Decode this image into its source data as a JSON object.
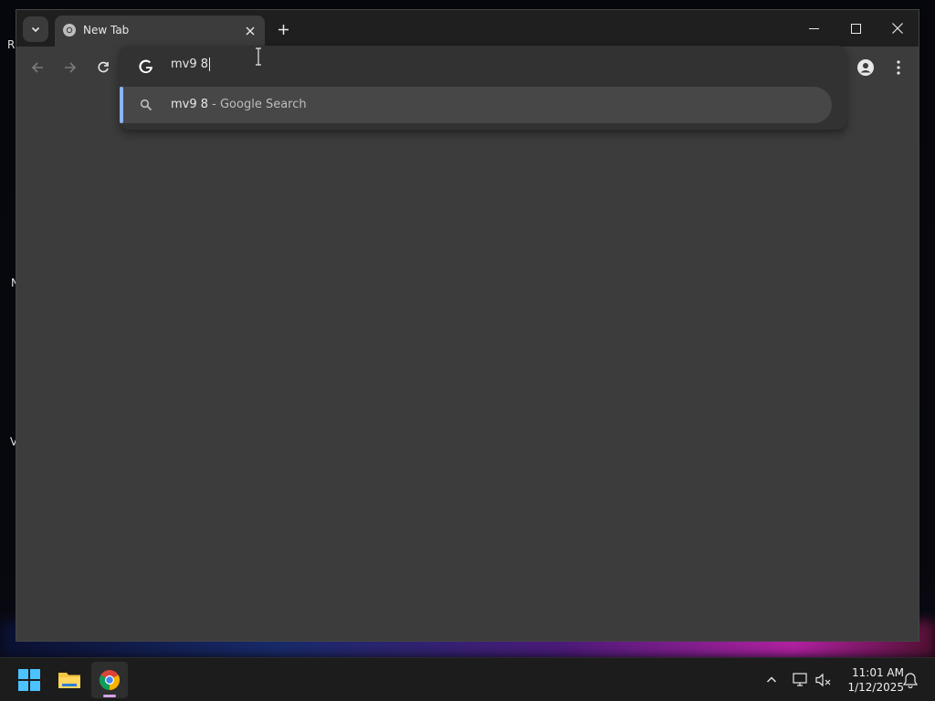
{
  "desktop": {
    "side_labels": [
      "R",
      "N",
      "V"
    ]
  },
  "browser": {
    "tab": {
      "title": "New Tab"
    },
    "omnibox": {
      "value": "mv9 8",
      "suggestions": [
        {
          "query": "mv9 8",
          "description": " - Google Search",
          "icon": "search-icon"
        }
      ]
    },
    "colors": {
      "accent": "#8ab4f8",
      "toolbar": "#3c3c3c",
      "titlebar": "#1f1f1f"
    }
  },
  "taskbar": {
    "apps": [
      {
        "name": "start",
        "icon": "windows-logo-icon"
      },
      {
        "name": "file-explorer",
        "icon": "folder-icon"
      },
      {
        "name": "chrome",
        "icon": "chrome-icon",
        "active": true
      }
    ],
    "clock": {
      "time": "11:01 AM",
      "date": "1/12/2025"
    }
  }
}
